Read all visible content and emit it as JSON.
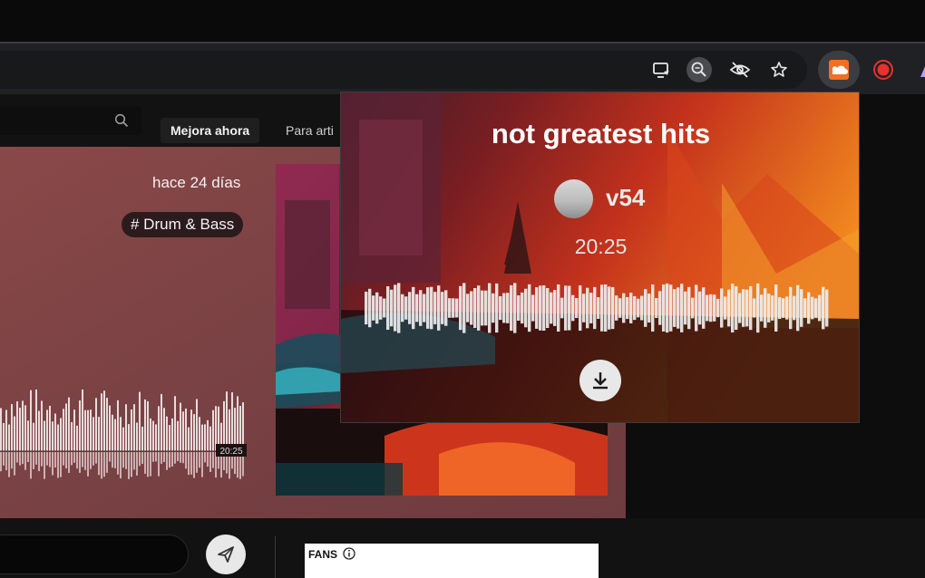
{
  "header": {
    "upgrade_label": "Mejora ahora",
    "for_artists_label": "Para arti"
  },
  "track": {
    "age": "hace 24 días",
    "tag": "# Drum & Bass",
    "duration": "20:25"
  },
  "fans": {
    "label": "FANS"
  },
  "popup": {
    "title": "not greatest hits",
    "username": "v54",
    "duration": "20:25"
  },
  "colors": {
    "extension_orange": "#f26f23",
    "record_red": "#e5322d",
    "panel_rose": "#7a4244"
  },
  "icons": [
    "screen-share-icon",
    "zoom-icon",
    "eye-off-icon",
    "star-icon",
    "soundcloud-extension-icon",
    "record-icon",
    "search-icon",
    "send-icon",
    "info-icon",
    "download-icon"
  ]
}
